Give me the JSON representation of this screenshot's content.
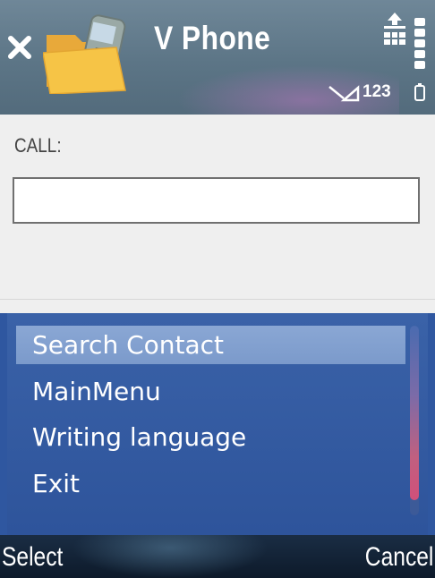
{
  "app": {
    "title": "V Phone"
  },
  "status": {
    "input_mode": "123"
  },
  "form": {
    "call_label": "CALL:",
    "call_value": ""
  },
  "menu": {
    "items": [
      {
        "label": "Search Contact",
        "selected": true
      },
      {
        "label": "MainMenu"
      },
      {
        "label": "Writing language"
      },
      {
        "label": "Exit"
      }
    ]
  },
  "softkeys": {
    "left": "Select",
    "right": "Cancel"
  },
  "colors": {
    "title_bar": "#5c7586",
    "menu_bg": "#2f57a0",
    "menu_highlight": "#8aa7d4",
    "softkey_bar": "#0d1a2a"
  },
  "icons": {
    "close": "close-icon",
    "app": "folder-phone-icon",
    "signal": "signal-icon",
    "upload": "upload-icon",
    "battery": "battery-icon"
  }
}
